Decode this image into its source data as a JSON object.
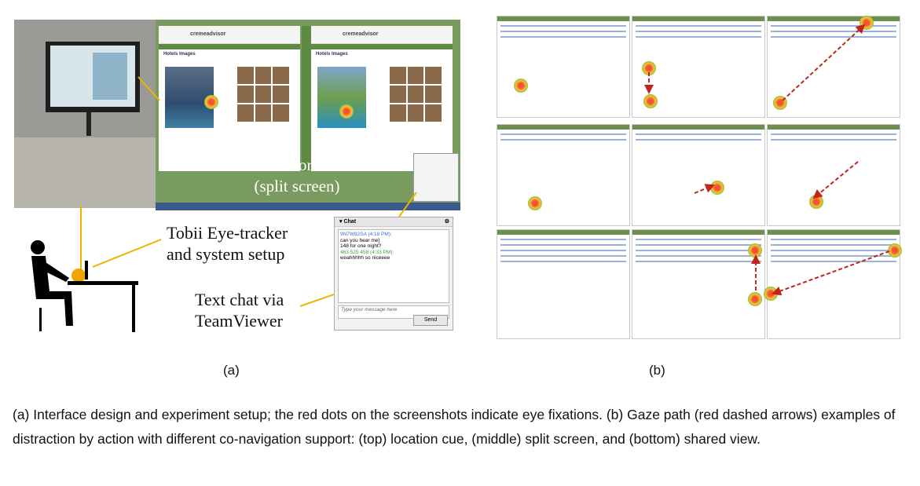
{
  "screenshot": {
    "logo": "cremeadvisor",
    "heading": "Hotels Images"
  },
  "overlay": {
    "line1": "cremeAdvisor Interface",
    "line2": "(split screen)"
  },
  "labels": {
    "tracker_line1": "Tobii Eye-tracker",
    "tracker_line2": "and system setup",
    "chat_line1": "Text chat via",
    "chat_line2": "TeamViewer"
  },
  "chat": {
    "title": "Chat",
    "messages": [
      {
        "who": "9N7W82SA (4:18 PM):",
        "text": "can you hear me]",
        "color": "#3a6fd8"
      },
      {
        "who": "",
        "text": "148 for one night?",
        "color": "#222"
      },
      {
        "who": "463 525 458 (4:33 PM):",
        "text": "woahhhhh so niceeee",
        "color": "#3aa63a"
      }
    ],
    "placeholder": "Type your message here",
    "send": "Send"
  },
  "sublabels": {
    "a": "(a)",
    "b": "(b)"
  },
  "caption": "(a) Interface design and experiment setup; the red dots on the screenshots indicate eye fixations. (b) Gaze path (red dashed arrows) examples of distraction by action with different co-navigation support: (top) location cue, (middle) split screen, and (bottom) shared view."
}
